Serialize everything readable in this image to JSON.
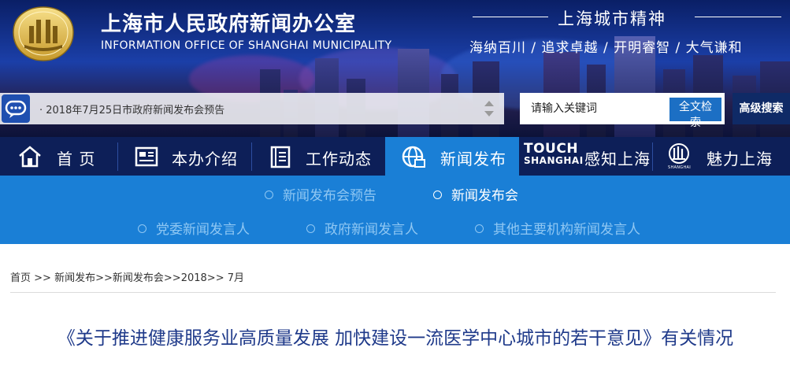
{
  "site": {
    "title": "上海市人民政府新闻办公室",
    "subtitle": "INFORMATION OFFICE OF SHANGHAI MUNICIPALITY"
  },
  "spirit": {
    "title": "上海城市精神",
    "phrases": "海纳百川 / 追求卓越 / 开明睿智 / 大气谦和"
  },
  "ticker": {
    "text": "· 2018年7月25日市政府新闻发布会预告",
    "icon": "chat-bubble-icon"
  },
  "search": {
    "placeholder": "请输入关键词",
    "button_label": "全文检索",
    "advanced_label": "高级搜索"
  },
  "nav": {
    "home": "首  页",
    "about": "本办介绍",
    "work": "工作动态",
    "news": "新闻发布",
    "touch_logo_top": "TOUCH",
    "touch_logo_bottom": "SHANGHAI",
    "touch": "感知上海",
    "charm": "魅力上海",
    "charm_logo_sub": "SHANGHAI"
  },
  "subnav": {
    "preview": "新闻发布会预告",
    "conference": "新闻发布会",
    "party": "党委新闻发言人",
    "gov": "政府新闻发言人",
    "other": "其他主要机构新闻发言人"
  },
  "breadcrumb": {
    "home": "首页",
    "sep1": " >> ",
    "news": "新闻发布",
    "sep2": ">>",
    "conference": "新闻发布会",
    "sep3": ">>",
    "year": "2018",
    "sep4": ">> ",
    "month": "7月"
  },
  "article": {
    "title": "《关于推进健康服务业高质量发展 加快建设一流医学中心城市的若干意见》有关情况"
  },
  "colors": {
    "nav_bg": "#0d1f58",
    "accent": "#1a7fd6",
    "title": "#1f3a8a"
  }
}
